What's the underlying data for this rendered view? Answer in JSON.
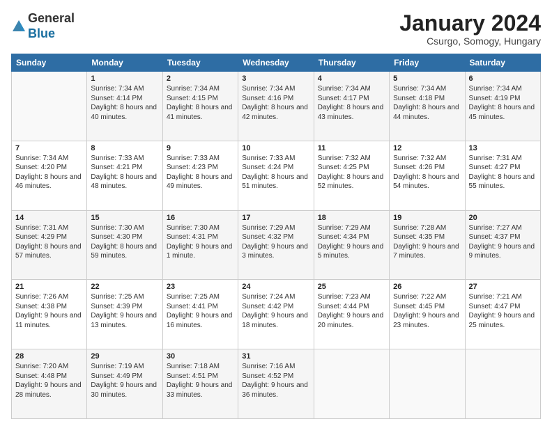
{
  "logo": {
    "general": "General",
    "blue": "Blue"
  },
  "title": "January 2024",
  "location": "Csurgo, Somogy, Hungary",
  "days_header": [
    "Sunday",
    "Monday",
    "Tuesday",
    "Wednesday",
    "Thursday",
    "Friday",
    "Saturday"
  ],
  "weeks": [
    [
      {
        "day": "",
        "sunrise": "",
        "sunset": "",
        "daylight": ""
      },
      {
        "day": "1",
        "sunrise": "Sunrise: 7:34 AM",
        "sunset": "Sunset: 4:14 PM",
        "daylight": "Daylight: 8 hours and 40 minutes."
      },
      {
        "day": "2",
        "sunrise": "Sunrise: 7:34 AM",
        "sunset": "Sunset: 4:15 PM",
        "daylight": "Daylight: 8 hours and 41 minutes."
      },
      {
        "day": "3",
        "sunrise": "Sunrise: 7:34 AM",
        "sunset": "Sunset: 4:16 PM",
        "daylight": "Daylight: 8 hours and 42 minutes."
      },
      {
        "day": "4",
        "sunrise": "Sunrise: 7:34 AM",
        "sunset": "Sunset: 4:17 PM",
        "daylight": "Daylight: 8 hours and 43 minutes."
      },
      {
        "day": "5",
        "sunrise": "Sunrise: 7:34 AM",
        "sunset": "Sunset: 4:18 PM",
        "daylight": "Daylight: 8 hours and 44 minutes."
      },
      {
        "day": "6",
        "sunrise": "Sunrise: 7:34 AM",
        "sunset": "Sunset: 4:19 PM",
        "daylight": "Daylight: 8 hours and 45 minutes."
      }
    ],
    [
      {
        "day": "7",
        "sunrise": "Sunrise: 7:34 AM",
        "sunset": "Sunset: 4:20 PM",
        "daylight": "Daylight: 8 hours and 46 minutes."
      },
      {
        "day": "8",
        "sunrise": "Sunrise: 7:33 AM",
        "sunset": "Sunset: 4:21 PM",
        "daylight": "Daylight: 8 hours and 48 minutes."
      },
      {
        "day": "9",
        "sunrise": "Sunrise: 7:33 AM",
        "sunset": "Sunset: 4:23 PM",
        "daylight": "Daylight: 8 hours and 49 minutes."
      },
      {
        "day": "10",
        "sunrise": "Sunrise: 7:33 AM",
        "sunset": "Sunset: 4:24 PM",
        "daylight": "Daylight: 8 hours and 51 minutes."
      },
      {
        "day": "11",
        "sunrise": "Sunrise: 7:32 AM",
        "sunset": "Sunset: 4:25 PM",
        "daylight": "Daylight: 8 hours and 52 minutes."
      },
      {
        "day": "12",
        "sunrise": "Sunrise: 7:32 AM",
        "sunset": "Sunset: 4:26 PM",
        "daylight": "Daylight: 8 hours and 54 minutes."
      },
      {
        "day": "13",
        "sunrise": "Sunrise: 7:31 AM",
        "sunset": "Sunset: 4:27 PM",
        "daylight": "Daylight: 8 hours and 55 minutes."
      }
    ],
    [
      {
        "day": "14",
        "sunrise": "Sunrise: 7:31 AM",
        "sunset": "Sunset: 4:29 PM",
        "daylight": "Daylight: 8 hours and 57 minutes."
      },
      {
        "day": "15",
        "sunrise": "Sunrise: 7:30 AM",
        "sunset": "Sunset: 4:30 PM",
        "daylight": "Daylight: 8 hours and 59 minutes."
      },
      {
        "day": "16",
        "sunrise": "Sunrise: 7:30 AM",
        "sunset": "Sunset: 4:31 PM",
        "daylight": "Daylight: 9 hours and 1 minute."
      },
      {
        "day": "17",
        "sunrise": "Sunrise: 7:29 AM",
        "sunset": "Sunset: 4:32 PM",
        "daylight": "Daylight: 9 hours and 3 minutes."
      },
      {
        "day": "18",
        "sunrise": "Sunrise: 7:29 AM",
        "sunset": "Sunset: 4:34 PM",
        "daylight": "Daylight: 9 hours and 5 minutes."
      },
      {
        "day": "19",
        "sunrise": "Sunrise: 7:28 AM",
        "sunset": "Sunset: 4:35 PM",
        "daylight": "Daylight: 9 hours and 7 minutes."
      },
      {
        "day": "20",
        "sunrise": "Sunrise: 7:27 AM",
        "sunset": "Sunset: 4:37 PM",
        "daylight": "Daylight: 9 hours and 9 minutes."
      }
    ],
    [
      {
        "day": "21",
        "sunrise": "Sunrise: 7:26 AM",
        "sunset": "Sunset: 4:38 PM",
        "daylight": "Daylight: 9 hours and 11 minutes."
      },
      {
        "day": "22",
        "sunrise": "Sunrise: 7:25 AM",
        "sunset": "Sunset: 4:39 PM",
        "daylight": "Daylight: 9 hours and 13 minutes."
      },
      {
        "day": "23",
        "sunrise": "Sunrise: 7:25 AM",
        "sunset": "Sunset: 4:41 PM",
        "daylight": "Daylight: 9 hours and 16 minutes."
      },
      {
        "day": "24",
        "sunrise": "Sunrise: 7:24 AM",
        "sunset": "Sunset: 4:42 PM",
        "daylight": "Daylight: 9 hours and 18 minutes."
      },
      {
        "day": "25",
        "sunrise": "Sunrise: 7:23 AM",
        "sunset": "Sunset: 4:44 PM",
        "daylight": "Daylight: 9 hours and 20 minutes."
      },
      {
        "day": "26",
        "sunrise": "Sunrise: 7:22 AM",
        "sunset": "Sunset: 4:45 PM",
        "daylight": "Daylight: 9 hours and 23 minutes."
      },
      {
        "day": "27",
        "sunrise": "Sunrise: 7:21 AM",
        "sunset": "Sunset: 4:47 PM",
        "daylight": "Daylight: 9 hours and 25 minutes."
      }
    ],
    [
      {
        "day": "28",
        "sunrise": "Sunrise: 7:20 AM",
        "sunset": "Sunset: 4:48 PM",
        "daylight": "Daylight: 9 hours and 28 minutes."
      },
      {
        "day": "29",
        "sunrise": "Sunrise: 7:19 AM",
        "sunset": "Sunset: 4:49 PM",
        "daylight": "Daylight: 9 hours and 30 minutes."
      },
      {
        "day": "30",
        "sunrise": "Sunrise: 7:18 AM",
        "sunset": "Sunset: 4:51 PM",
        "daylight": "Daylight: 9 hours and 33 minutes."
      },
      {
        "day": "31",
        "sunrise": "Sunrise: 7:16 AM",
        "sunset": "Sunset: 4:52 PM",
        "daylight": "Daylight: 9 hours and 36 minutes."
      },
      {
        "day": "",
        "sunrise": "",
        "sunset": "",
        "daylight": ""
      },
      {
        "day": "",
        "sunrise": "",
        "sunset": "",
        "daylight": ""
      },
      {
        "day": "",
        "sunrise": "",
        "sunset": "",
        "daylight": ""
      }
    ]
  ]
}
